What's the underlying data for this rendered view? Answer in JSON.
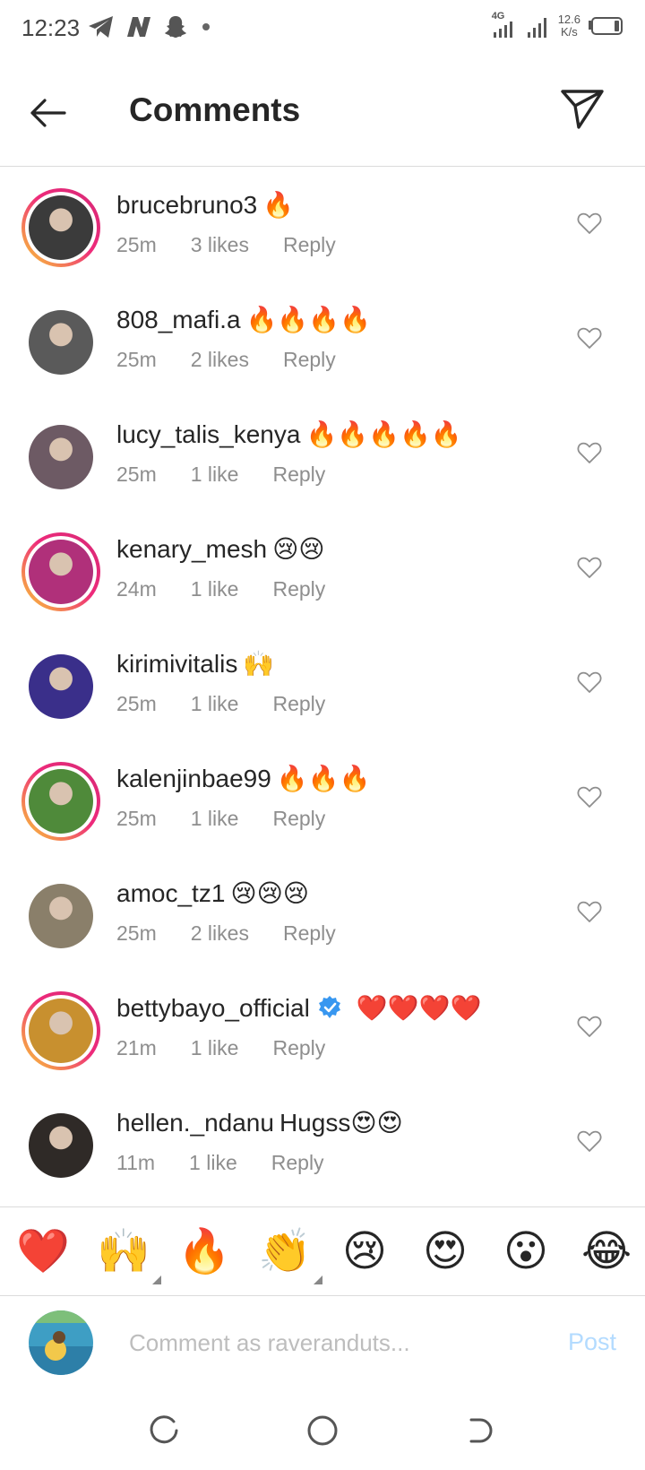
{
  "status_bar": {
    "time": "12:23",
    "icons": [
      "telegram-icon",
      "n-icon",
      "snapchat-icon"
    ],
    "network": "4G",
    "speed_value": "12.6",
    "speed_unit": "K/s"
  },
  "header": {
    "title": "Comments"
  },
  "comments": [
    {
      "username": "brucebruno3",
      "text": "🔥",
      "time": "25m",
      "likes": "3 likes",
      "reply": "Reply",
      "story_ring": true,
      "avatar_color": "#3b3b3b"
    },
    {
      "username": "808_mafi.a",
      "text": "🔥🔥🔥🔥",
      "time": "25m",
      "likes": "2 likes",
      "reply": "Reply",
      "story_ring": false,
      "avatar_color": "#5a5a5a"
    },
    {
      "username": "lucy_talis_kenya",
      "text": "🔥🔥🔥🔥🔥",
      "time": "25m",
      "likes": "1 like",
      "reply": "Reply",
      "story_ring": false,
      "avatar_color": "#6d5a64"
    },
    {
      "username": "kenary_mesh",
      "text": "😢😢",
      "time": "24m",
      "likes": "1 like",
      "reply": "Reply",
      "story_ring": true,
      "avatar_color": "#b0307a"
    },
    {
      "username": "kirimivitalis",
      "text": "🙌",
      "time": "25m",
      "likes": "1 like",
      "reply": "Reply",
      "story_ring": false,
      "avatar_color": "#3a2f8a"
    },
    {
      "username": "kalenjinbae99",
      "text": "🔥🔥🔥",
      "time": "25m",
      "likes": "1 like",
      "reply": "Reply",
      "story_ring": true,
      "avatar_color": "#4f8a3a"
    },
    {
      "username": "amoc_tz1",
      "text": "😢😢😢",
      "time": "25m",
      "likes": "2 likes",
      "reply": "Reply",
      "story_ring": false,
      "avatar_color": "#8a7f6a"
    },
    {
      "username": "bettybayo_official",
      "text": "❤️❤️❤️❤️",
      "time": "21m",
      "likes": "1 like",
      "reply": "Reply",
      "story_ring": true,
      "verified": true,
      "avatar_color": "#c8902f"
    },
    {
      "username": "hellen._ndanu",
      "text": "Hugss😍😍",
      "time": "11m",
      "likes": "1 like",
      "reply": "Reply",
      "story_ring": false,
      "avatar_color": "#2f2a27"
    }
  ],
  "emoji_bar": [
    {
      "emoji": "❤️",
      "name": "red-heart",
      "variants": false
    },
    {
      "emoji": "🙌",
      "name": "raising-hands",
      "variants": true
    },
    {
      "emoji": "🔥",
      "name": "fire",
      "variants": false
    },
    {
      "emoji": "👏",
      "name": "clapping-hands",
      "variants": true
    },
    {
      "emoji": "😢",
      "name": "crying-face",
      "variants": false
    },
    {
      "emoji": "😍",
      "name": "heart-eyes",
      "variants": false
    },
    {
      "emoji": "😮",
      "name": "surprised-face",
      "variants": false
    },
    {
      "emoji": "😂",
      "name": "tears-of-joy",
      "variants": false
    }
  ],
  "composer": {
    "placeholder": "Comment as raveranduts...",
    "post_label": "Post",
    "avatar_color": "#3e9ec4"
  },
  "colors": {
    "story_ring_start": "#f9ce34",
    "story_ring_end": "#d62976",
    "muted_text": "#8e8e8e",
    "post_disabled": "#b3dbff",
    "verified": "#3897f0"
  }
}
